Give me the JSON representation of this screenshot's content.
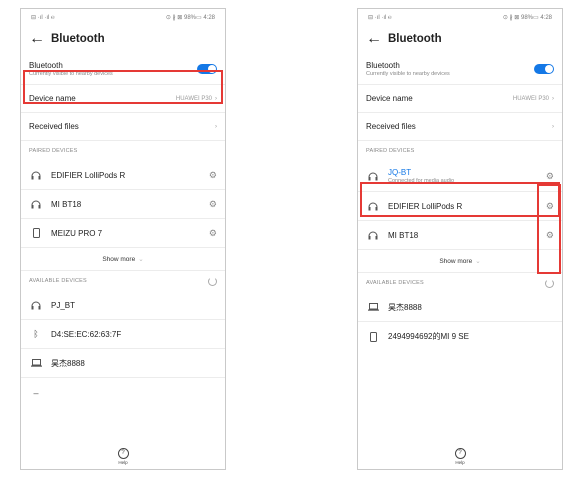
{
  "left": {
    "status_left": "⊟ ·ıl ·ıl ℮",
    "status_right": "⊙ ∦ ⊠ 98%▭ 4:28",
    "title": "Bluetooth",
    "bluetooth_label": "Bluetooth",
    "bluetooth_sub": "Currently visible to nearby devices",
    "device_name_label": "Device name",
    "device_name_value": "HUAWEI P30",
    "received_files_label": "Received files",
    "paired_header": "PAIRED DEVICES",
    "paired": [
      {
        "name": "EDIFIER LolliPods R",
        "icon": "headset-icon"
      },
      {
        "name": "MI BT18",
        "icon": "headset-icon"
      },
      {
        "name": "MEIZU PRO 7",
        "icon": "phone-icon"
      }
    ],
    "show_more": "Show more",
    "available_header": "AVAILABLE DEVICES",
    "available": [
      {
        "name": "PJ_BT",
        "icon": "headset-icon"
      },
      {
        "name": "D4:SE:EC:62:63:7F",
        "icon": "bluetooth-icon"
      },
      {
        "name": "昊杰8888",
        "icon": "laptop-icon"
      },
      {
        "name": "",
        "icon": "generic-icon"
      }
    ],
    "help": "Help"
  },
  "right": {
    "status_left": "⊟ ·ıl ·ıl ℮",
    "status_right": "⊙ ∦ ⊠ 98%▭ 4:28",
    "title": "Bluetooth",
    "bluetooth_label": "Bluetooth",
    "bluetooth_sub": "Currently visible to nearby devices",
    "device_name_label": "Device name",
    "device_name_value": "HUAWEI P30",
    "received_files_label": "Received files",
    "paired_header": "PAIRED DEVICES",
    "connected": {
      "name": "JQ-BT",
      "status": "Connected for media audio"
    },
    "paired": [
      {
        "name": "EDIFIER LolliPods R"
      },
      {
        "name": "MI BT18"
      }
    ],
    "show_more": "Show more",
    "available_header": "AVAILABLE DEVICES",
    "available": [
      {
        "name": "昊杰8888",
        "icon": "laptop-icon"
      },
      {
        "name": "2494994692的MI 9 SE",
        "icon": "phone-icon"
      }
    ],
    "help": "Help"
  },
  "colors": {
    "accent": "#1478e6",
    "highlight": "#e53935"
  }
}
